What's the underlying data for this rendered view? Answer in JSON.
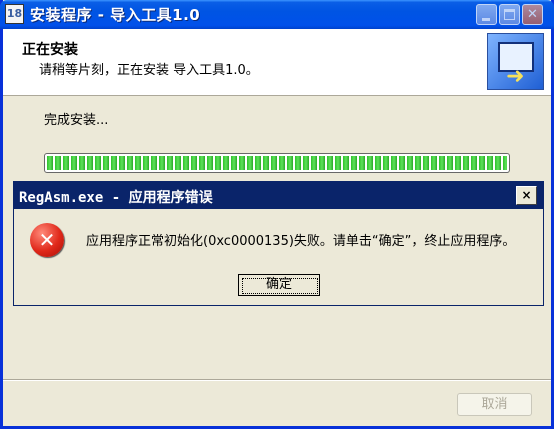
{
  "installer": {
    "title": "安装程序 - 导入工具1.0",
    "icon_label": "18",
    "header_title": "正在安装",
    "header_subtitle": "请稍等片刻，正在安装 导入工具1.0。",
    "status": "完成安装...",
    "progress_percent": 100,
    "cancel_label": "取消",
    "cancel_enabled": false
  },
  "dialog": {
    "title": "RegAsm.exe - 应用程序错误",
    "close_glyph": "×",
    "error_glyph": "✕",
    "message": "应用程序正常初始化(0xc0000135)失败。请单击“确定”，终止应用程序。",
    "ok_label": "确定"
  },
  "titlebar_icons": [
    "minimize-icon",
    "maximize-icon",
    "close-icon"
  ],
  "colors": {
    "titlebar_blue": "#0054e3",
    "dialog_titlebar": "#0a246a",
    "progress_green": "#2ec02b",
    "error_red": "#e0281a"
  }
}
